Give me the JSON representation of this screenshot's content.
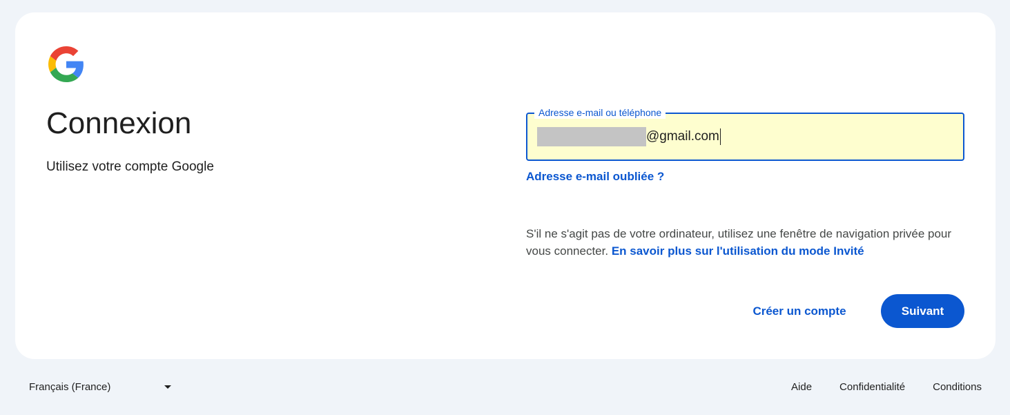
{
  "brand": {
    "logo_icon": "google-g-icon",
    "colors": {
      "blue": "#4285F4",
      "red": "#EA4335",
      "yellow": "#FBBC05",
      "green": "#34A853",
      "accent": "#0b57d0",
      "field_fill": "#fefecf"
    }
  },
  "header": {
    "title": "Connexion",
    "subtitle": "Utilisez votre compte Google"
  },
  "form": {
    "email_label": "Adresse e-mail ou téléphone",
    "email_value_suffix": "@gmail.com",
    "forgot_email_link": "Adresse e-mail oubliée ?",
    "notice_text": "S'il ne s'agit pas de votre ordinateur, utilisez une fenêtre de navigation privée pour vous connecter. ",
    "notice_link": "En savoir plus sur l'utilisation du mode Invité"
  },
  "actions": {
    "create_account": "Créer un compte",
    "next": "Suivant"
  },
  "footer": {
    "language": "Français (France)",
    "links": [
      "Aide",
      "Confidentialité",
      "Conditions"
    ]
  }
}
